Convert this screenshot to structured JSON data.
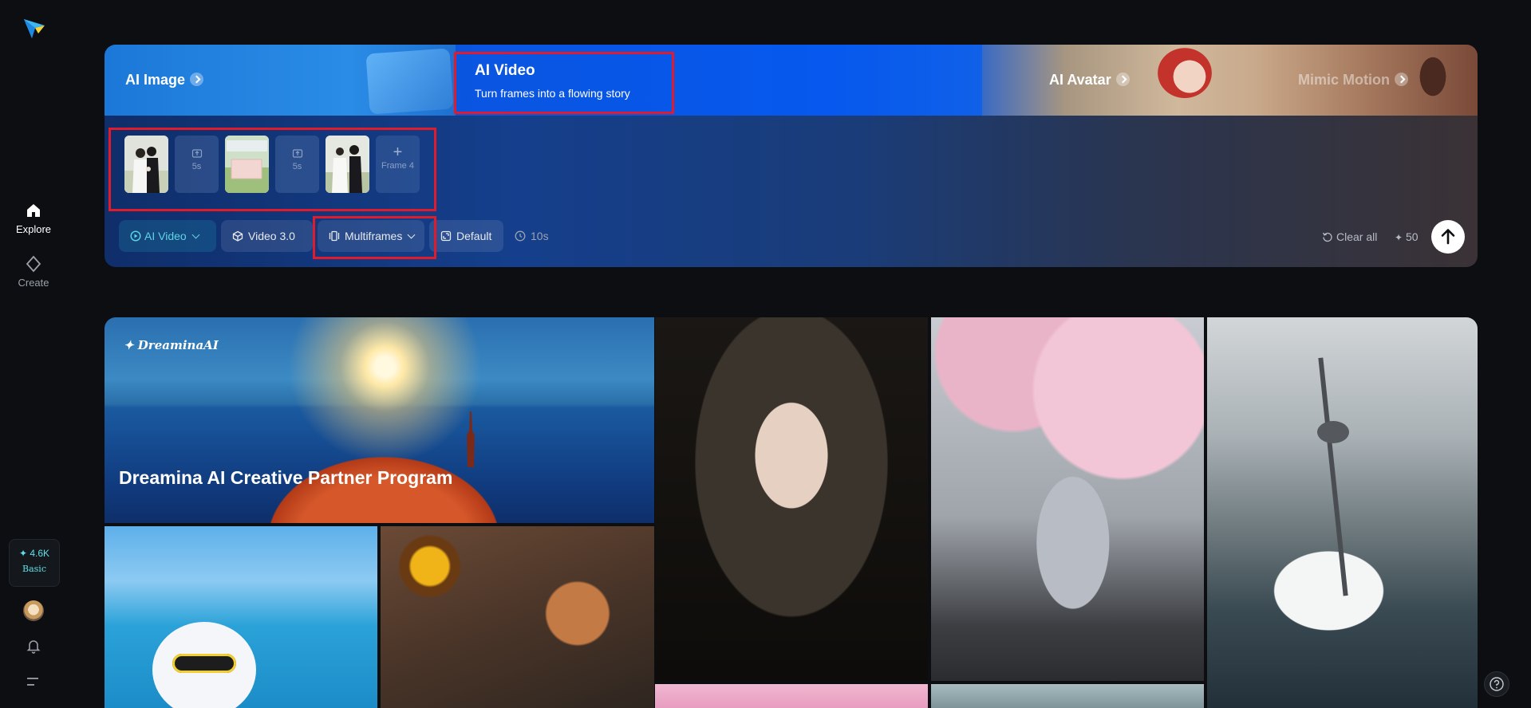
{
  "sidebar": {
    "nav": [
      {
        "label": "Explore",
        "icon": "home-icon",
        "active": true
      },
      {
        "label": "Create",
        "icon": "diamond-icon",
        "active": false
      }
    ],
    "credits": {
      "value": "✦ 4.6K",
      "plan": "Basic"
    }
  },
  "hero": {
    "tabs": [
      {
        "label": "AI Image",
        "icon": "whale-icon"
      },
      {
        "label": "AI Video",
        "subtitle": "Turn frames into a flowing story",
        "icon": "plane-icon",
        "active": true
      },
      {
        "label": "AI Avatar",
        "icon": "girl-avatar-icon"
      },
      {
        "label": "Mimic Motion",
        "icon": "dancer-icon"
      }
    ],
    "frames": [
      {
        "type": "photo"
      },
      {
        "type": "slot",
        "duration": "5s"
      },
      {
        "type": "photo"
      },
      {
        "type": "slot",
        "duration": "5s"
      },
      {
        "type": "photo"
      },
      {
        "type": "add",
        "label": "Frame 4"
      }
    ],
    "toolbar": {
      "mode": "AI Video",
      "model": "Video 3.0",
      "frames_mode": "Multiframes",
      "style": "Default",
      "duration": "10s"
    },
    "clear_label": "Clear all",
    "cost": "50"
  },
  "gallery": {
    "banner_brand": "DreaminaAI",
    "banner_title": "Dreamina AI Creative Partner Program"
  },
  "colors": {
    "accent": "#5fd4e6",
    "highlight": "#e01b2b",
    "tab_video": "#0658ee",
    "background": "#0c0e12"
  }
}
